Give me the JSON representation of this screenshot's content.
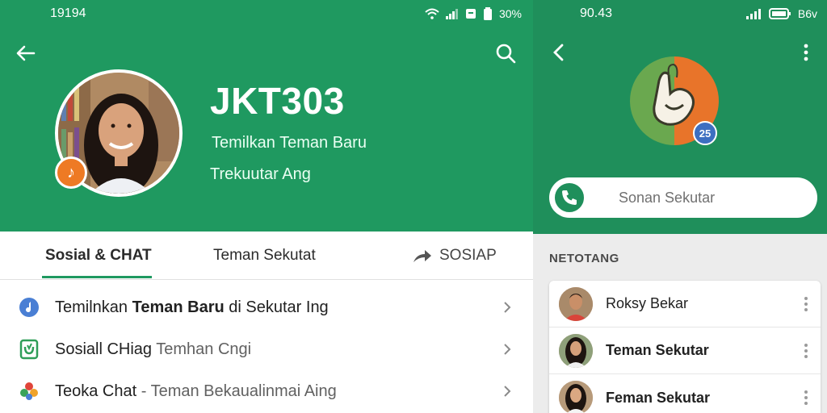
{
  "left": {
    "status_time": "19194",
    "status_battery": "30%",
    "profile": {
      "title": "JKT303",
      "subtitle1": "Temilkan Teman Baru",
      "subtitle2": "Trekuutar Ang"
    },
    "tabs": [
      {
        "label": "Sosial & CHAT"
      },
      {
        "label": "Teman Sekutat"
      },
      {
        "label": "SOSIAP"
      }
    ],
    "rows": [
      {
        "text_a": "Temilnkan ",
        "text_b": "Teman Baru",
        "text_c": " di Sekutar Ing",
        "icon": "music-note-icon"
      },
      {
        "text_a": "Sosiall CHiag",
        "text_b": "",
        "text_c": " Temhan Cngi",
        "icon": "shield-check-icon"
      },
      {
        "text_a": "Teoka Chat",
        "text_b": "",
        "text_c": " - Teman Bekaualinmai Aing",
        "icon": "flower-icon"
      }
    ],
    "colors": {
      "header": "#1f9960",
      "accent": "#ee7a24"
    }
  },
  "right": {
    "status_time": "90.43",
    "status_right": "B6v",
    "logo_badge": "25",
    "search": {
      "placeholder": "Sonan Sekutar"
    },
    "section_label": "NETOTANG",
    "contacts": [
      {
        "name": "Roksy Bekar"
      },
      {
        "name": "Teman Sekutar"
      },
      {
        "name": "Feman Sekutar"
      }
    ],
    "colors": {
      "header": "#1f8f5b",
      "logo_green": "#6aa84f",
      "logo_orange": "#e8742a"
    }
  }
}
